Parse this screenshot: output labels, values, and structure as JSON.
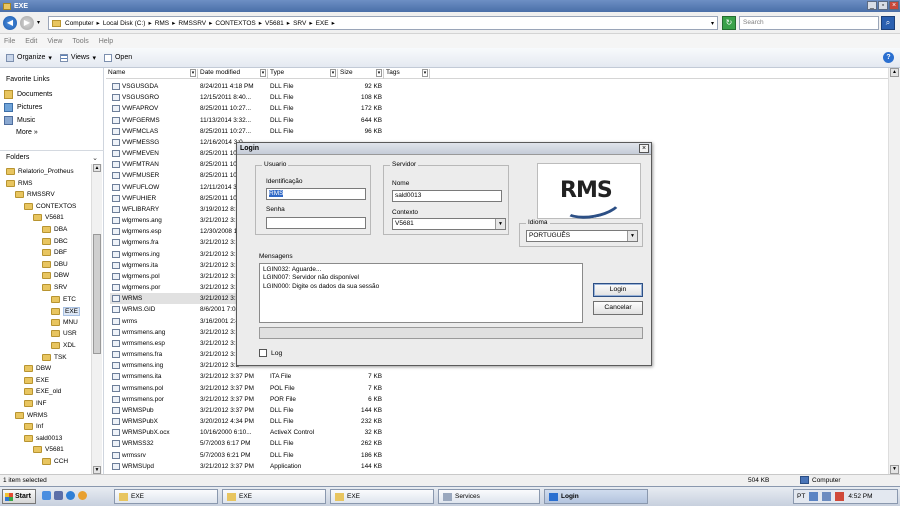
{
  "window": {
    "title": "EXE"
  },
  "address": {
    "crumbs": [
      "Computer",
      "Local Disk (C:)",
      "RMS",
      "RMSSRV",
      "CONTEXTOS",
      "V5681",
      "SRV",
      "EXE"
    ],
    "search_placeholder": "Search"
  },
  "menu": [
    "File",
    "Edit",
    "View",
    "Tools",
    "Help"
  ],
  "commands": {
    "organize": "Organize",
    "views": "Views",
    "open": "Open"
  },
  "favorites": {
    "title": "Favorite Links",
    "items": [
      "Documents",
      "Pictures",
      "Music"
    ],
    "more": "More »"
  },
  "folders": {
    "title": "Folders",
    "tree": [
      {
        "label": "Relatorio_Protheus",
        "indent": 1
      },
      {
        "label": "RMS",
        "indent": 1
      },
      {
        "label": "RMSSRV",
        "indent": 2
      },
      {
        "label": "CONTEXTOS",
        "indent": 3
      },
      {
        "label": "V5681",
        "indent": 4
      },
      {
        "label": "DBA",
        "indent": 5
      },
      {
        "label": "DBC",
        "indent": 5
      },
      {
        "label": "DBF",
        "indent": 5
      },
      {
        "label": "DBU",
        "indent": 5
      },
      {
        "label": "DBW",
        "indent": 5
      },
      {
        "label": "SRV",
        "indent": 5
      },
      {
        "label": "ETC",
        "indent": 6
      },
      {
        "label": "EXE",
        "indent": 6,
        "selected": true
      },
      {
        "label": "MNU",
        "indent": 6
      },
      {
        "label": "USR",
        "indent": 6
      },
      {
        "label": "XDL",
        "indent": 6
      },
      {
        "label": "TSK",
        "indent": 5
      },
      {
        "label": "DBW",
        "indent": 3
      },
      {
        "label": "EXE",
        "indent": 3
      },
      {
        "label": "EXE_old",
        "indent": 3
      },
      {
        "label": "INF",
        "indent": 3
      },
      {
        "label": "WRMS",
        "indent": 2
      },
      {
        "label": "Inf",
        "indent": 3
      },
      {
        "label": "sald0013",
        "indent": 3
      },
      {
        "label": "V5681",
        "indent": 4
      },
      {
        "label": "CCH",
        "indent": 5
      }
    ]
  },
  "columns": [
    "Name",
    "Date modified",
    "Type",
    "Size",
    "Tags"
  ],
  "files": [
    {
      "name": "VSGUSGDA",
      "date": "8/24/2011 4:18 PM",
      "type": "DLL File",
      "size": "92 KB"
    },
    {
      "name": "VSGUSGRO",
      "date": "12/15/2011 8:40...",
      "type": "DLL File",
      "size": "108 KB"
    },
    {
      "name": "VWFAPROV",
      "date": "8/25/2011 10:27...",
      "type": "DLL File",
      "size": "172 KB"
    },
    {
      "name": "VWFGERMS",
      "date": "11/13/2014 3:32...",
      "type": "DLL File",
      "size": "644 KB"
    },
    {
      "name": "VWFMCLAS",
      "date": "8/25/2011 10:27...",
      "type": "DLL File",
      "size": "96 KB"
    },
    {
      "name": "VWFMESSG",
      "date": "12/16/2014 3:0",
      "type": "",
      "size": ""
    },
    {
      "name": "VWFMEVEN",
      "date": "8/25/2011 10:2",
      "type": "",
      "size": ""
    },
    {
      "name": "VWFMTRAN",
      "date": "8/25/2011 10:",
      "type": "",
      "size": ""
    },
    {
      "name": "VWFMUSER",
      "date": "8/25/2011 10:2",
      "type": "",
      "size": ""
    },
    {
      "name": "VWFUFLOW",
      "date": "12/11/2014 3:",
      "type": "",
      "size": ""
    },
    {
      "name": "VWFUHIER",
      "date": "8/25/2011 10:",
      "type": "",
      "size": ""
    },
    {
      "name": "WFLIBRARY",
      "date": "3/19/2012 8:3",
      "type": "",
      "size": ""
    },
    {
      "name": "wlgrmens.ang",
      "date": "3/21/2012 3:3",
      "type": "",
      "size": ""
    },
    {
      "name": "wlgrmens.esp",
      "date": "12/30/2008 11",
      "type": "",
      "size": ""
    },
    {
      "name": "wlgrmens.fra",
      "date": "3/21/2012 3:3",
      "type": "",
      "size": ""
    },
    {
      "name": "wlgrmens.ing",
      "date": "3/21/2012 3:3",
      "type": "",
      "size": ""
    },
    {
      "name": "wlgrmens.ita",
      "date": "3/21/2012 3:3",
      "type": "",
      "size": ""
    },
    {
      "name": "wlgrmens.pol",
      "date": "3/21/2012 3:3",
      "type": "",
      "size": ""
    },
    {
      "name": "wlgrmens.por",
      "date": "3/21/2012 3:3",
      "type": "",
      "size": ""
    },
    {
      "name": "WRMS",
      "date": "3/21/2012 3:3",
      "type": "",
      "size": "",
      "selected": true
    },
    {
      "name": "WRMS.GID",
      "date": "8/6/2001 7:03",
      "type": "",
      "size": ""
    },
    {
      "name": "wrms",
      "date": "3/16/2001 2:4",
      "type": "",
      "size": ""
    },
    {
      "name": "wrmsmens.ang",
      "date": "3/21/2012 3:3",
      "type": "",
      "size": ""
    },
    {
      "name": "wrmsmens.esp",
      "date": "3/21/2012 3:3",
      "type": "",
      "size": ""
    },
    {
      "name": "wrmsmens.fra",
      "date": "3/21/2012 3:3",
      "type": "",
      "size": ""
    },
    {
      "name": "wrmsmens.ing",
      "date": "3/21/2012 3:3",
      "type": "",
      "size": ""
    },
    {
      "name": "wrmsmens.ita",
      "date": "3/21/2012 3:37 PM",
      "type": "ITA File",
      "size": "7 KB"
    },
    {
      "name": "wrmsmens.pol",
      "date": "3/21/2012 3:37 PM",
      "type": "POL File",
      "size": "7 KB"
    },
    {
      "name": "wrmsmens.por",
      "date": "3/21/2012 3:37 PM",
      "type": "POR File",
      "size": "6 KB"
    },
    {
      "name": "WRMSPub",
      "date": "3/21/2012 3:37 PM",
      "type": "DLL File",
      "size": "144 KB"
    },
    {
      "name": "WRMSPubX",
      "date": "3/20/2012 4:34 PM",
      "type": "DLL File",
      "size": "232 KB"
    },
    {
      "name": "WRMSPubX.ocx",
      "date": "10/16/2000 6:10...",
      "type": "ActiveX Control",
      "size": "32 KB"
    },
    {
      "name": "WRMSS32",
      "date": "5/7/2003 6:17 PM",
      "type": "DLL File",
      "size": "262 KB"
    },
    {
      "name": "wrmssrv",
      "date": "5/7/2003 6:21 PM",
      "type": "DLL File",
      "size": "186 KB"
    },
    {
      "name": "WRMSUpd",
      "date": "3/21/2012 3:37 PM",
      "type": "Application",
      "size": "144 KB"
    }
  ],
  "status": {
    "items_selected": "1 item selected",
    "size": "504 KB",
    "location": "Computer"
  },
  "taskbar": {
    "start": "Start",
    "tasks": [
      "EXE",
      "EXE",
      "EXE",
      "Services",
      "Login"
    ],
    "lang": "PT",
    "clock": "4:52 PM"
  },
  "login": {
    "title": "Login",
    "usuario_legend": "Usuario",
    "identificacao_label": "Identificação",
    "identificacao_value": "RMS",
    "senha_label": "Senha",
    "senha_value": "",
    "servidor_legend": "Servidor",
    "nome_label": "Nome",
    "nome_value": "sald0013",
    "contexto_label": "Contexto",
    "contexto_value": "V5681",
    "logo_text": "RMS",
    "idioma_legend": "Idioma",
    "idioma_value": "PORTUGUÊS",
    "mensagens_label": "Mensagens",
    "messages": [
      "LGIN032: Aguarde...",
      "LGIN007: Servidor não disponível",
      "LGIN000: Digite os dados da sua sessão"
    ],
    "login_button": "Login",
    "cancel_button": "Cancelar",
    "log_checkbox": "Log",
    "progress": 0
  },
  "colors": {
    "accent": "#3169c6",
    "progress": "#3aa14a"
  }
}
